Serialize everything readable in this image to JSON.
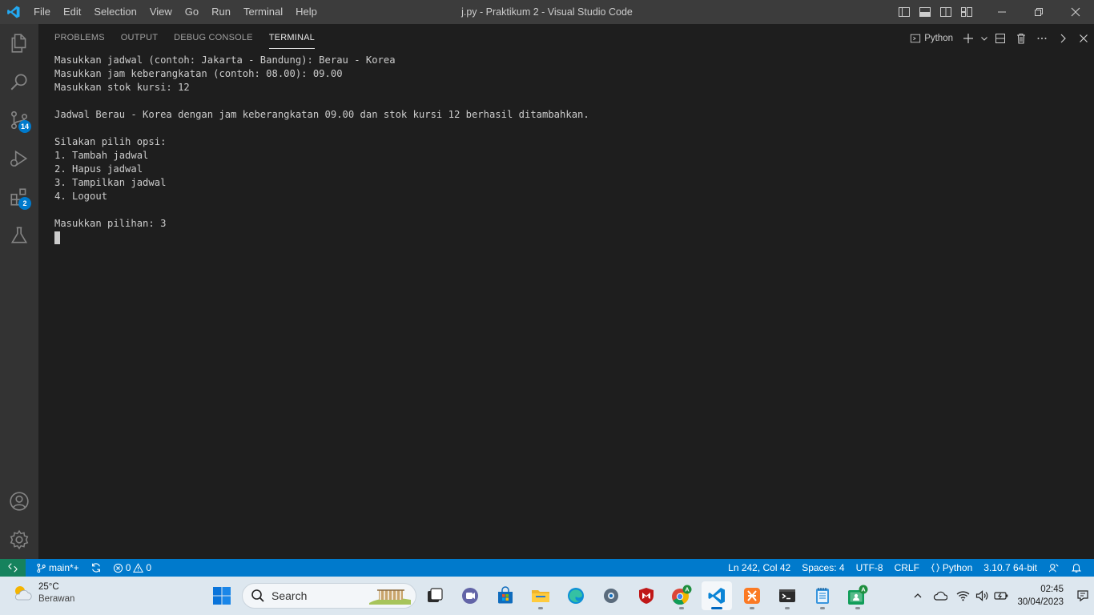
{
  "window": {
    "title": "j.py - Praktikum 2 - Visual Studio Code"
  },
  "menu": [
    "File",
    "Edit",
    "Selection",
    "View",
    "Go",
    "Run",
    "Terminal",
    "Help"
  ],
  "activity_bar": {
    "source_control_badge": "14",
    "extensions_badge": "2"
  },
  "panel": {
    "tabs": [
      "PROBLEMS",
      "OUTPUT",
      "DEBUG CONSOLE",
      "TERMINAL"
    ],
    "active_tab": "TERMINAL",
    "terminal_profile": "Python"
  },
  "terminal": {
    "lines": [
      "Masukkan jadwal (contoh: Jakarta - Bandung): Berau - Korea",
      "Masukkan jam keberangkatan (contoh: 08.00): 09.00",
      "Masukkan stok kursi: 12",
      "",
      "Jadwal Berau - Korea dengan jam keberangkatan 09.00 dan stok kursi 12 berhasil ditambahkan.",
      "",
      "Silakan pilih opsi:",
      "1. Tambah jadwal",
      "2. Hapus jadwal",
      "3. Tampilkan jadwal",
      "4. Logout",
      "",
      "Masukkan pilihan: 3"
    ]
  },
  "status_bar": {
    "branch": "main*+",
    "errors": "0",
    "warnings": "0",
    "position": "Ln 242, Col 42",
    "spaces": "Spaces: 4",
    "encoding": "UTF-8",
    "eol": "CRLF",
    "language": "Python",
    "interpreter": "3.10.7 64-bit"
  },
  "taskbar": {
    "weather_temp": "25°C",
    "weather_desc": "Berawan",
    "search_placeholder": "Search",
    "time": "02:45",
    "date": "30/04/2023"
  },
  "colors": {
    "titlebar": "#3c3c3c",
    "activitybar": "#333333",
    "editor_bg": "#1e1e1e",
    "statusbar": "#007acc",
    "remote": "#16825d",
    "taskbar": "#dde7ef"
  }
}
